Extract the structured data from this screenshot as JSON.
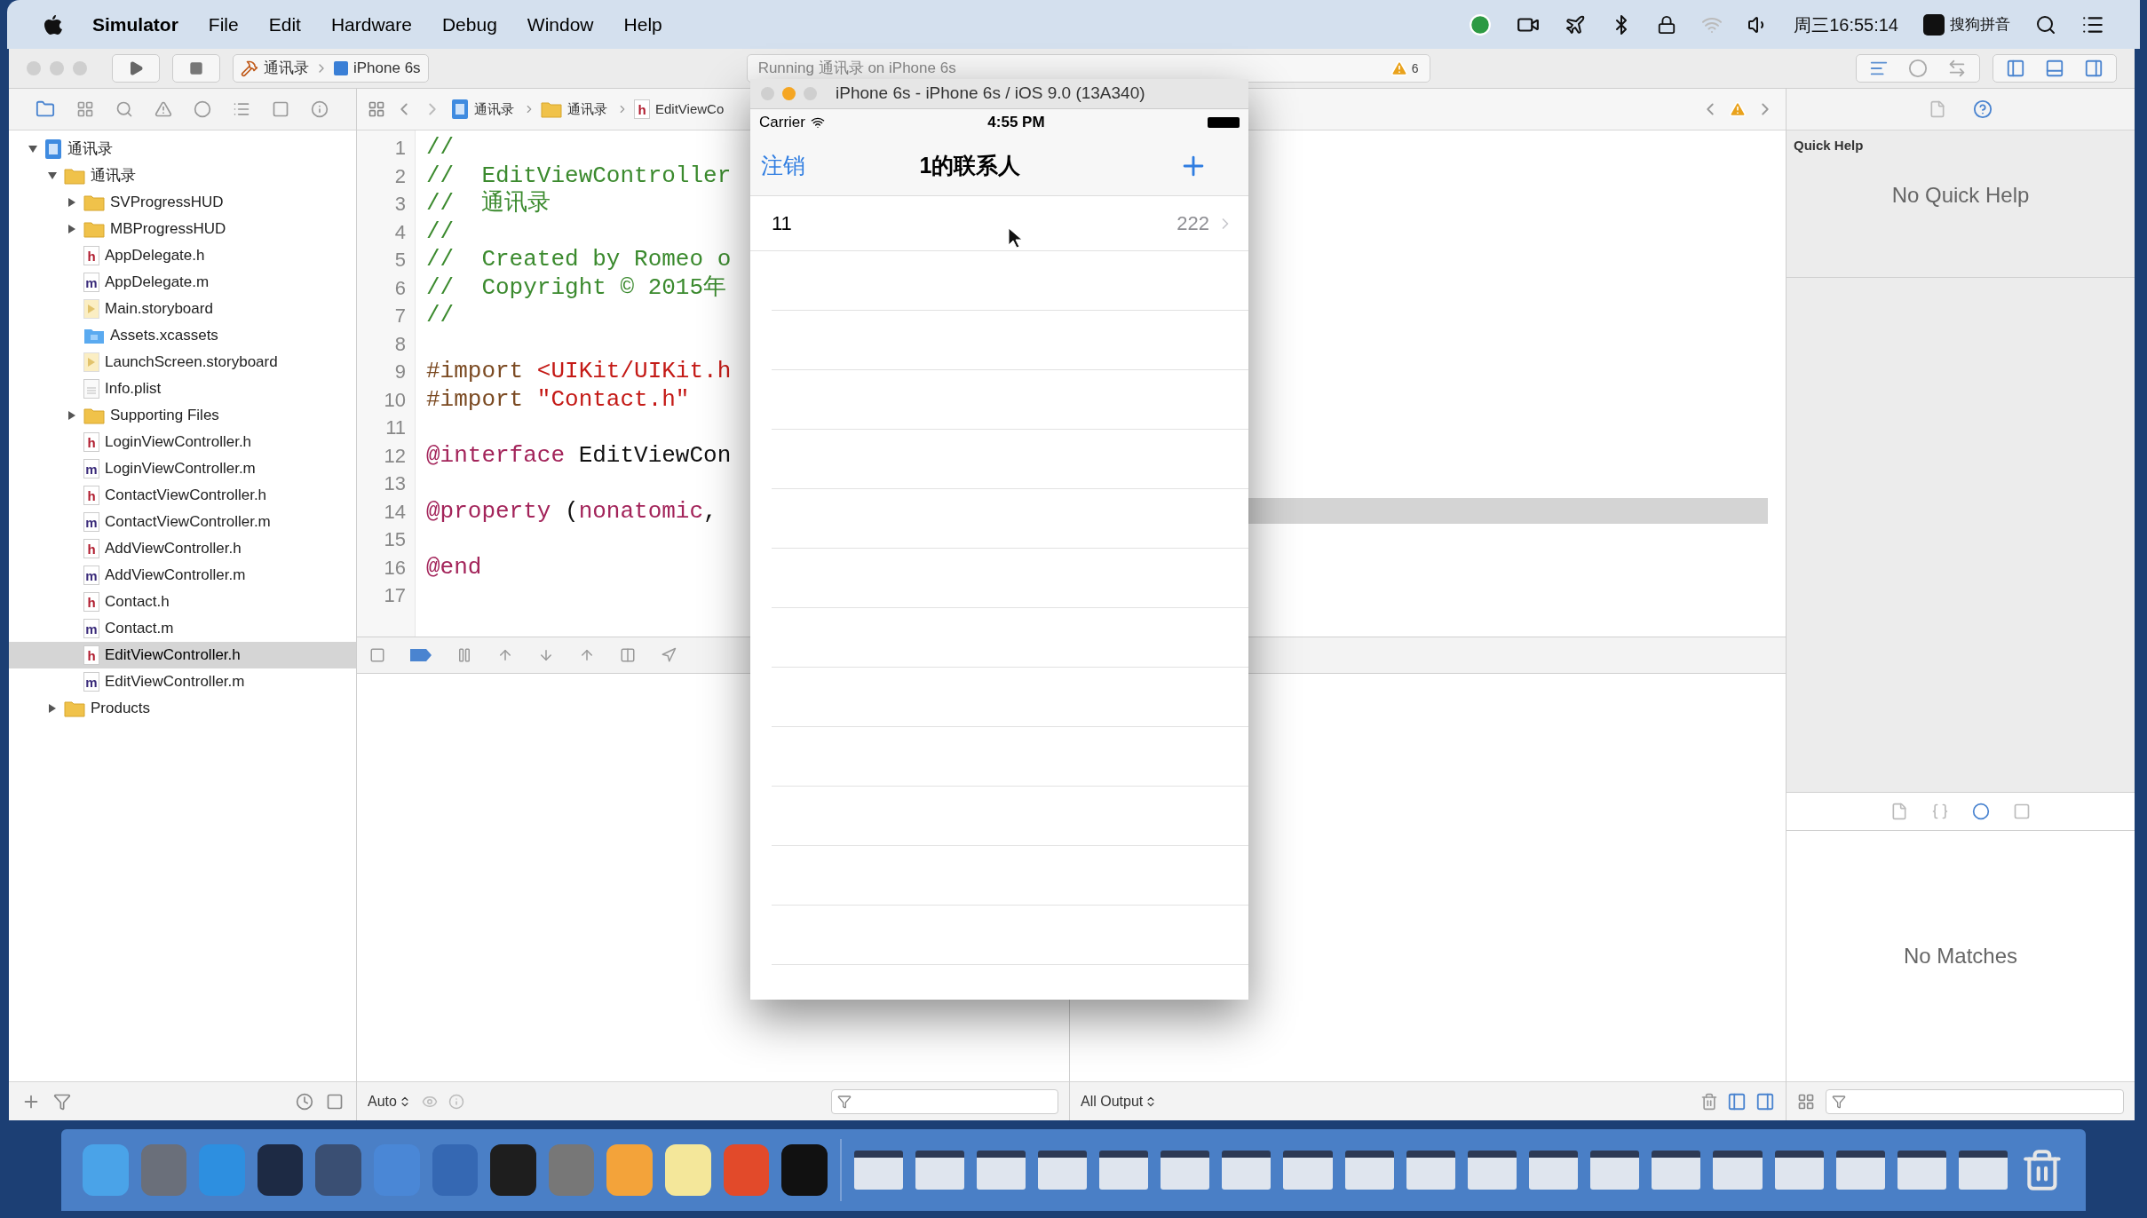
{
  "menu_bar": {
    "app": "Simulator",
    "menus": [
      "File",
      "Edit",
      "Hardware",
      "Debug",
      "Window",
      "Help"
    ],
    "clock": "周三16:55:14",
    "input_method": "搜狗拼音"
  },
  "toolbar": {
    "scheme": "通讯录",
    "device": "iPhone 6s",
    "activity": "Running 通讯录 on iPhone 6s",
    "warnings": "6"
  },
  "navigator": {
    "tree": [
      {
        "label": "通讯录",
        "kind": "project",
        "expanded": true,
        "selected": false,
        "children": [
          {
            "label": "通讯录",
            "kind": "folder",
            "expanded": true,
            "selected": false,
            "children": [
              {
                "label": "SVProgressHUD",
                "kind": "folder",
                "expanded": false,
                "selected": false
              },
              {
                "label": "MBProgressHUD",
                "kind": "folder",
                "expanded": false,
                "selected": false
              },
              {
                "label": "AppDelegate.h",
                "kind": "header",
                "glyph": "h",
                "selected": false
              },
              {
                "label": "AppDelegate.m",
                "kind": "source",
                "glyph": "m",
                "selected": false
              },
              {
                "label": "Main.storyboard",
                "kind": "storyboard",
                "selected": false
              },
              {
                "label": "Assets.xcassets",
                "kind": "assets",
                "selected": false
              },
              {
                "label": "LaunchScreen.storyboard",
                "kind": "storyboard",
                "selected": false
              },
              {
                "label": "Info.plist",
                "kind": "plist",
                "selected": false
              },
              {
                "label": "Supporting Files",
                "kind": "folder",
                "expanded": false,
                "selected": false
              },
              {
                "label": "LoginViewController.h",
                "kind": "header",
                "glyph": "h",
                "selected": false
              },
              {
                "label": "LoginViewController.m",
                "kind": "source",
                "glyph": "m",
                "selected": false
              },
              {
                "label": "ContactViewController.h",
                "kind": "header",
                "glyph": "h",
                "selected": false
              },
              {
                "label": "ContactViewController.m",
                "kind": "source",
                "glyph": "m",
                "selected": false
              },
              {
                "label": "AddViewController.h",
                "kind": "header",
                "glyph": "h",
                "selected": false
              },
              {
                "label": "AddViewController.m",
                "kind": "source",
                "glyph": "m",
                "selected": false
              },
              {
                "label": "Contact.h",
                "kind": "header",
                "glyph": "h",
                "selected": false
              },
              {
                "label": "Contact.m",
                "kind": "source",
                "glyph": "m",
                "selected": false
              },
              {
                "label": "EditViewController.h",
                "kind": "header",
                "glyph": "h",
                "selected": true
              },
              {
                "label": "EditViewController.m",
                "kind": "source",
                "glyph": "m",
                "selected": false
              }
            ]
          },
          {
            "label": "Products",
            "kind": "folder",
            "expanded": false,
            "selected": false
          }
        ]
      }
    ]
  },
  "jump_bar": {
    "crumbs": [
      {
        "label": "通讯录",
        "kind": "project"
      },
      {
        "label": "通讯录",
        "kind": "folder"
      },
      {
        "label": "EditViewCo",
        "kind": "header",
        "glyph": "h"
      }
    ]
  },
  "editor": {
    "lines": [
      {
        "number": "1",
        "highlighted": false,
        "segments": [
          {
            "text": "//",
            "kind": "comment"
          }
        ]
      },
      {
        "number": "2",
        "highlighted": false,
        "segments": [
          {
            "text": "//  EditViewController",
            "kind": "comment"
          }
        ]
      },
      {
        "number": "3",
        "highlighted": false,
        "segments": [
          {
            "text": "//  通讯录",
            "kind": "comment"
          }
        ]
      },
      {
        "number": "4",
        "highlighted": false,
        "segments": [
          {
            "text": "//",
            "kind": "comment"
          }
        ]
      },
      {
        "number": "5",
        "highlighted": false,
        "segments": [
          {
            "text": "//  Created by Romeo o",
            "kind": "comment"
          }
        ]
      },
      {
        "number": "6",
        "highlighted": false,
        "segments": [
          {
            "text": "//  Copyright © 2015年",
            "kind": "comment"
          }
        ]
      },
      {
        "number": "7",
        "highlighted": false,
        "segments": [
          {
            "text": "//",
            "kind": "comment"
          }
        ]
      },
      {
        "number": "8",
        "highlighted": false
      },
      {
        "number": "9",
        "highlighted": false,
        "segments": [
          {
            "text": "#import ",
            "kind": "directive"
          },
          {
            "text": "<UIKit/UIKit.h",
            "kind": "string"
          }
        ]
      },
      {
        "number": "10",
        "highlighted": false,
        "segments": [
          {
            "text": "#import ",
            "kind": "directive"
          },
          {
            "text": "\"Contact.h\"",
            "kind": "string"
          }
        ]
      },
      {
        "number": "11",
        "highlighted": false
      },
      {
        "number": "12",
        "highlighted": false,
        "segments": [
          {
            "text": "@interface",
            "kind": "keyword"
          },
          {
            "text": " EditViewCon",
            "kind": "plain"
          }
        ]
      },
      {
        "number": "13",
        "highlighted": false
      },
      {
        "number": "14",
        "highlighted": true,
        "segments": [
          {
            "text": "@property",
            "kind": "keyword"
          },
          {
            "text": " (",
            "kind": "plain"
          },
          {
            "text": "nonatomic",
            "kind": "keyword"
          },
          {
            "text": ",",
            "kind": "plain"
          }
        ]
      },
      {
        "number": "15",
        "highlighted": false
      },
      {
        "number": "16",
        "highlighted": false,
        "segments": [
          {
            "text": "@end",
            "kind": "keyword"
          }
        ]
      },
      {
        "number": "17",
        "highlighted": false
      }
    ]
  },
  "debug": {
    "scope": "Auto",
    "output": "All Output"
  },
  "inspector": {
    "quick_help_title": "Quick Help",
    "quick_help_empty": "No Quick Help",
    "library_empty": "No Matches"
  },
  "simulator": {
    "title": "iPhone 6s - iPhone 6s / iOS 9.0 (13A340)",
    "carrier": "Carrier",
    "time": "4:55 PM",
    "nav_left": "注销",
    "nav_title": "1的联系人",
    "rows": [
      {
        "name": "11",
        "detail": "222"
      }
    ]
  }
}
